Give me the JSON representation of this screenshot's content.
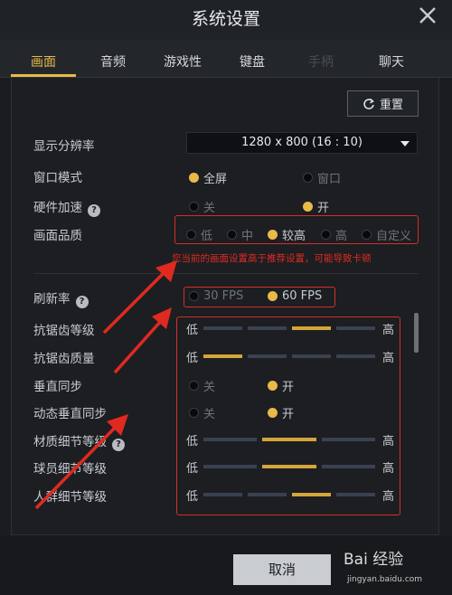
{
  "window": {
    "title": "系统设置"
  },
  "tabs": [
    {
      "label": "画面"
    },
    {
      "label": "音频"
    },
    {
      "label": "游戏性"
    },
    {
      "label": "键盘"
    },
    {
      "label": "手柄"
    },
    {
      "label": "聊天"
    }
  ],
  "reset_label": "重置",
  "settings": {
    "resolution": {
      "label": "显示分辨率",
      "value": "1280 x 800 (16 : 10)"
    },
    "window_mode": {
      "label": "窗口模式",
      "options": [
        "全屏",
        "窗口"
      ],
      "selected": "全屏"
    },
    "hw_accel": {
      "label": "硬件加速",
      "help": "?",
      "options": [
        "关",
        "开"
      ],
      "selected": "开"
    },
    "quality": {
      "label": "画面品质",
      "options": [
        "低",
        "中",
        "较高",
        "高",
        "自定义"
      ],
      "selected": "较高"
    },
    "warning": "您当前的画面设置高于推荐设置，可能导致卡顿",
    "refresh": {
      "label": "刷新率",
      "help": "?",
      "options": [
        "30 FPS",
        "60 FPS"
      ],
      "selected": "60 FPS"
    },
    "sliders": [
      {
        "label": "抗锯齿等级",
        "low": "低",
        "high": "高",
        "level": 3,
        "of": 4
      },
      {
        "label": "抗锯齿质量",
        "low": "低",
        "high": "高",
        "level": 1,
        "of": 4
      },
      {
        "label": "材质细节等级",
        "help": "?",
        "low": "低",
        "high": "高",
        "level": 2,
        "of": 3
      },
      {
        "label": "球员细节等级",
        "low": "低",
        "high": "高",
        "level": 2,
        "of": 3
      },
      {
        "label": "人群细节等级",
        "low": "低",
        "high": "高",
        "level": 3,
        "of": 4
      }
    ],
    "vsync": {
      "label": "垂直同步",
      "options": [
        "关",
        "开"
      ],
      "selected": "开"
    },
    "dyn_vsync": {
      "label": "动态垂直同步",
      "options": [
        "关",
        "开"
      ],
      "selected": "开"
    }
  },
  "footer": {
    "cancel_label": "取消",
    "watermark": "Bai 经验",
    "watermark_sub": "jingyan.baidu.com"
  },
  "colors": {
    "accent": "#e9b94a",
    "annotation": "#e02a20"
  }
}
